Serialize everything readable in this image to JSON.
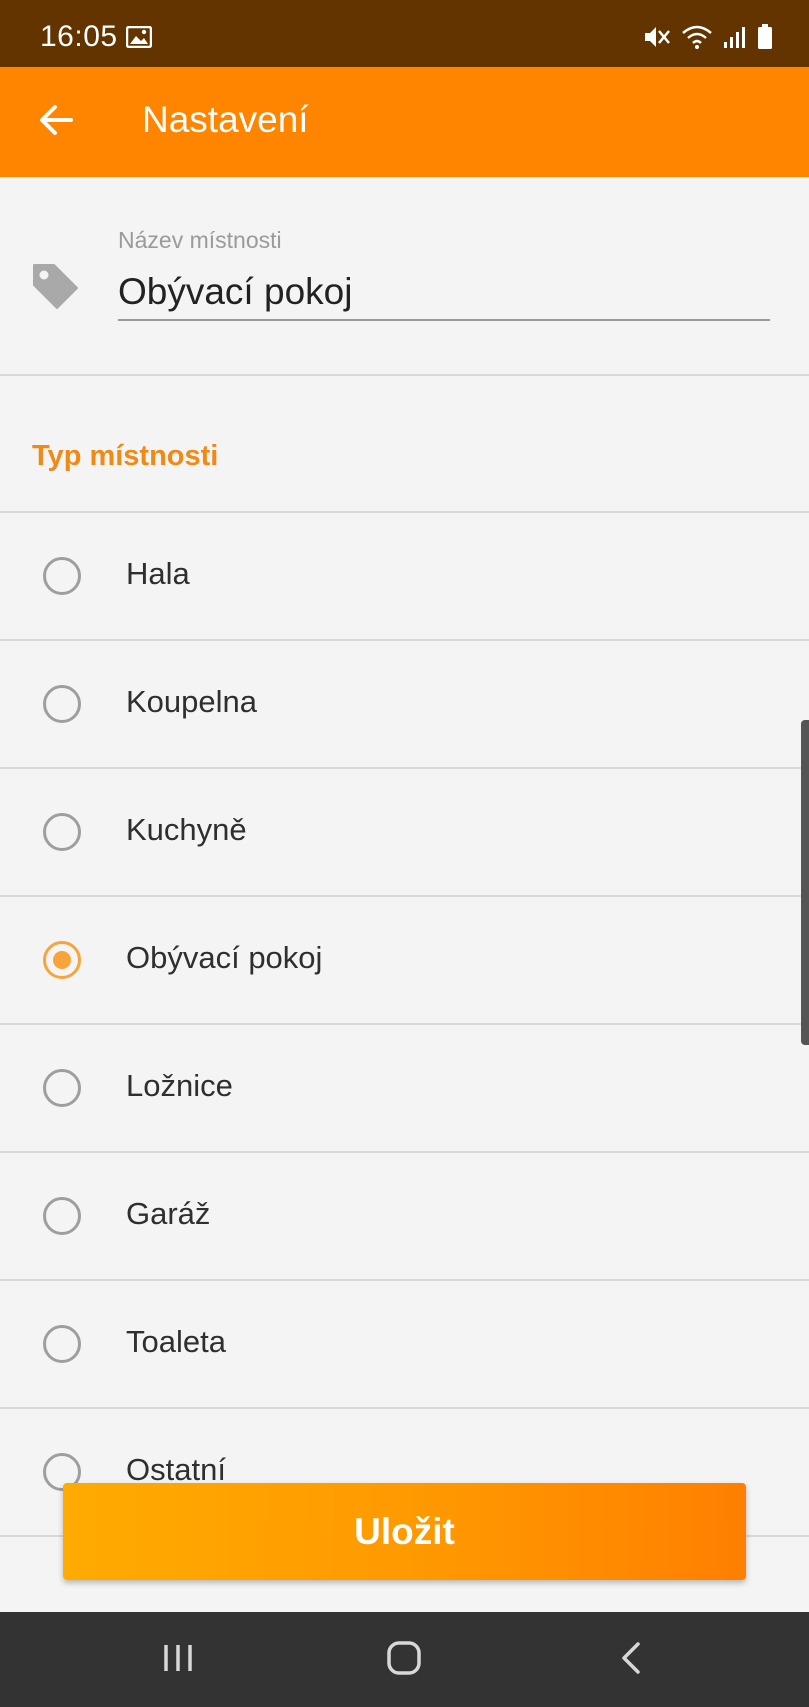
{
  "status_bar": {
    "time": "16:05"
  },
  "app_bar": {
    "title": "Nastavení"
  },
  "room_name": {
    "label": "Název místnosti",
    "value": "Obývací pokoj"
  },
  "room_type": {
    "header": "Typ místnosti",
    "selected": "Obývací pokoj",
    "options": [
      "Hala",
      "Koupelna",
      "Kuchyně",
      "Obývací pokoj",
      "Ložnice",
      "Garáž",
      "Toaleta",
      "Ostatní"
    ]
  },
  "actions": {
    "save_label": "Uložit"
  },
  "colors": {
    "status_bar": "#633300",
    "app_bar": "#ff8400",
    "accent": "#f7a43a"
  },
  "icons": [
    "back-arrow-icon",
    "tag-icon",
    "image-icon",
    "mute-icon",
    "wifi-icon",
    "signal-icon",
    "battery-icon",
    "recents-icon",
    "home-icon",
    "nav-back-icon"
  ]
}
